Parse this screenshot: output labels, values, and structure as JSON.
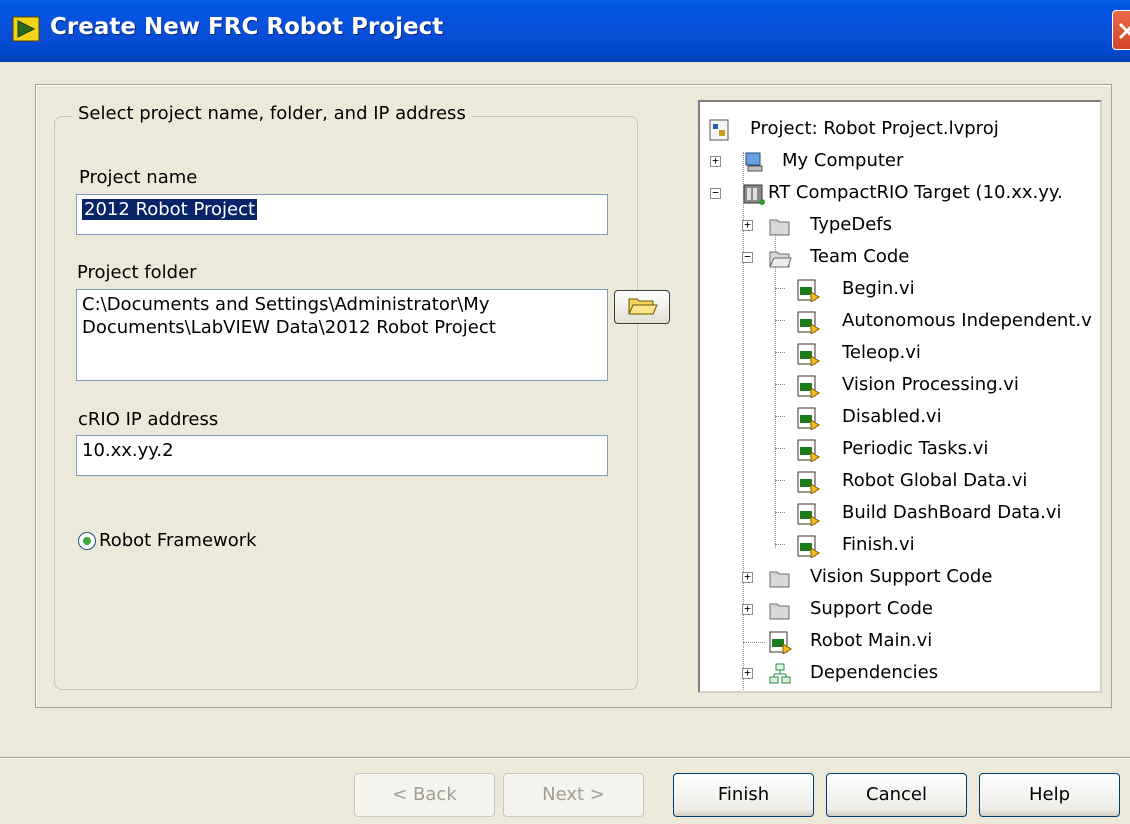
{
  "window": {
    "title": "Create New FRC Robot Project",
    "app_icon": "labview-icon",
    "close_icon": "close-icon"
  },
  "form": {
    "group_title": "Select project name, folder, and IP address",
    "project_name_label": "Project name",
    "project_name_value": "2012 Robot Project",
    "project_folder_label": "Project folder",
    "project_folder_value_line1": "C:\\Documents and Settings\\Administrator\\My",
    "project_folder_value_line2": "Documents\\LabVIEW Data\\2012 Robot Project",
    "crio_ip_label": "cRIO IP address",
    "crio_ip_value": "10.xx.yy.2",
    "framework_option": "Robot Framework",
    "framework_selected": true
  },
  "tree": {
    "root": "Project: Robot Project.lvproj",
    "my_computer": "My Computer",
    "target": "RT CompactRIO Target (10.xx.yy.",
    "typedefs": "TypeDefs",
    "team_code": "Team Code",
    "team_code_items": [
      "Begin.vi",
      "Autonomous Independent.v",
      "Teleop.vi",
      "Vision Processing.vi",
      "Disabled.vi",
      "Periodic Tasks.vi",
      "Robot Global Data.vi",
      "Build DashBoard Data.vi",
      "Finish.vi"
    ],
    "vision_support": "Vision Support Code",
    "support_code": "Support Code",
    "robot_main": "Robot Main.vi",
    "dependencies": "Dependencies"
  },
  "buttons": {
    "back": "< Back",
    "next": "Next >",
    "finish": "Finish",
    "cancel": "Cancel",
    "help": "Help"
  },
  "colors": {
    "titlebar": "#0055e5",
    "dialog_bg": "#ece9d8",
    "selection": "#0a246a"
  }
}
